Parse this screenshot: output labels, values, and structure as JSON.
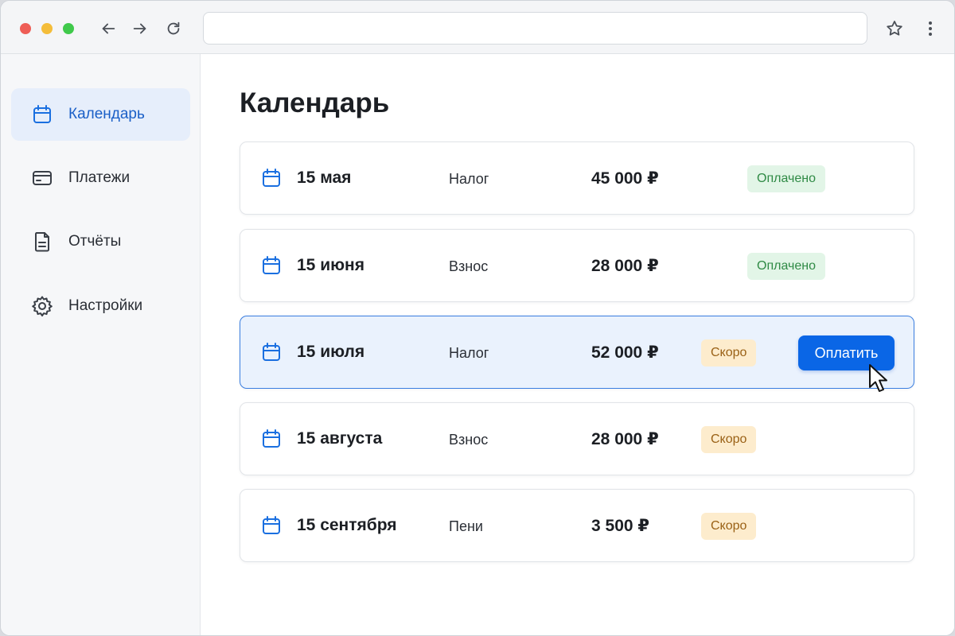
{
  "browser": {
    "address_value": "",
    "icons": [
      "back-arrow-icon",
      "forward-arrow-icon",
      "reload-icon",
      "star-icon",
      "more-vertical-icon"
    ]
  },
  "sidebar": {
    "items": [
      {
        "label": "Календарь",
        "icon": "calendar-icon",
        "active": true
      },
      {
        "label": "Платежи",
        "icon": "credit-card-icon",
        "active": false
      },
      {
        "label": "Отчёты",
        "icon": "document-icon",
        "active": false
      },
      {
        "label": "Настройки",
        "icon": "gear-icon",
        "active": false
      }
    ]
  },
  "main": {
    "title": "Календарь",
    "rows": [
      {
        "date": "15 мая",
        "type": "Налог",
        "amount": "45 000 ₽",
        "status": "Оплачено"
      },
      {
        "date": "15 июня",
        "type": "Взнос",
        "amount": "28 000 ₽",
        "status": "Оплачено"
      },
      {
        "date": "15 июля",
        "type": "Налог",
        "amount": "52 000 ₽",
        "status": "Скоро",
        "action": "Оплатить"
      },
      {
        "date": "15 августа",
        "type": "Взнос",
        "amount": "28 000 ₽",
        "status": "Скоро"
      },
      {
        "date": "15 сентября",
        "type": "Пени",
        "amount": "3 500 ₽",
        "status": "Скоро"
      }
    ]
  },
  "colors": {
    "accent": "#0a66e6",
    "active_nav_bg": "#e6eefb",
    "paid_badge_bg": "#e2f5e7",
    "paid_badge_text": "#2f8a45",
    "soon_badge_bg": "#fdeccd",
    "soon_badge_text": "#9a6116",
    "highlight_row_bg": "#eaf2fd"
  }
}
